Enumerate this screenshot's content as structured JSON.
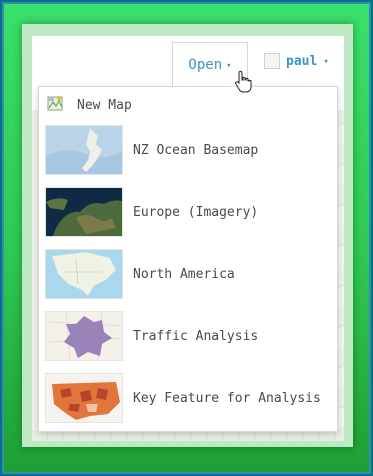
{
  "header": {
    "open_label": "Open",
    "open_caret": "▾",
    "user_name": "paul",
    "user_caret": "▾"
  },
  "menu": {
    "new_map_label": "New Map",
    "items": [
      {
        "label": "NZ Ocean Basemap",
        "thumb_icon": "ocean-basemap-thumbnail"
      },
      {
        "label": "Europe (Imagery)",
        "thumb_icon": "europe-imagery-thumbnail"
      },
      {
        "label": "North America",
        "thumb_icon": "north-america-thumbnail"
      },
      {
        "label": "Traffic Analysis",
        "thumb_icon": "traffic-analysis-thumbnail"
      },
      {
        "label": "Key Feature for Analysis",
        "thumb_icon": "key-feature-thumbnail"
      }
    ]
  },
  "colors": {
    "accent": "#3f93c5",
    "frame_green": "#2fc850",
    "frame_blue": "#2f8fb0",
    "text": "#4a4a4a"
  }
}
